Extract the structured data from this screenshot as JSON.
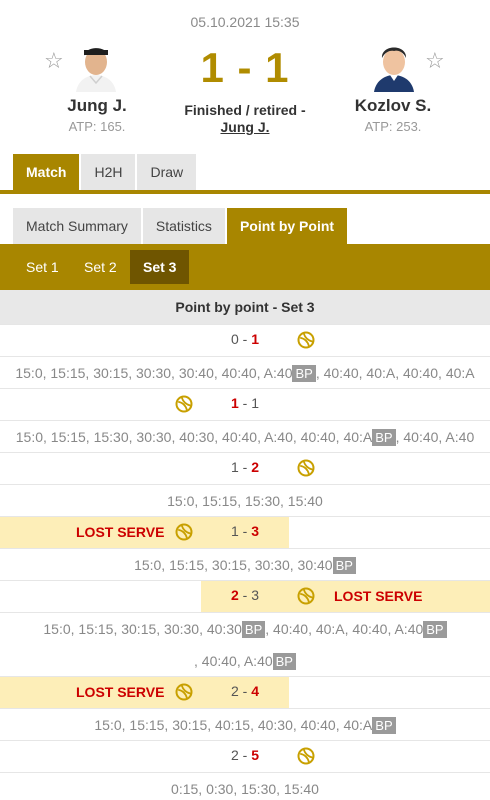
{
  "header": {
    "datetime": "05.10.2021 15:35",
    "score": "1 - 1",
    "status_line1": "Finished / retired -",
    "status_line2": "Jung J.",
    "home": {
      "name": "Jung J.",
      "rank": "ATP: 165."
    },
    "away": {
      "name": "Kozlov S.",
      "rank": "ATP: 253."
    }
  },
  "main_tabs": [
    "Match",
    "H2H",
    "Draw"
  ],
  "sub_tabs": [
    "Match Summary",
    "Statistics",
    "Point by Point"
  ],
  "set_tabs": [
    "Set 1",
    "Set 2",
    "Set 3"
  ],
  "section_title": "Point by point - Set 3",
  "lost_serve_label": "LOST SERVE",
  "games": [
    {
      "home": "0",
      "away": "1",
      "sep": "-",
      "points": [
        "15:0, 15:15, 30:15, 30:30, 30:40, 40:40, A:40",
        "BP",
        ", 40:40, 40:A, 40:40, 40:A"
      ]
    },
    {
      "home": "1",
      "away": "1",
      "sep": "-",
      "points": [
        "15:0, 15:15, 15:30, 30:30, 40:30, 40:40, A:40, 40:40, 40:A",
        "BP",
        ", 40:40, A:40"
      ]
    },
    {
      "home": "1",
      "away": "2",
      "sep": "-",
      "points": [
        "15:0, 15:15, 15:30, 15:40"
      ]
    },
    {
      "home": "1",
      "away": "3",
      "sep": "-",
      "points": [
        "15:0, 15:15, 30:15, 30:30, 30:40",
        "BP"
      ]
    },
    {
      "home": "2",
      "away": "3",
      "sep": "-",
      "points": [
        "15:0, 15:15, 30:15, 30:30, 40:30",
        "BP",
        ", 40:40, 40:A, 40:40, A:40",
        "BP",
        ", 40:40, A:40",
        "BP"
      ]
    },
    {
      "home": "2",
      "away": "4",
      "sep": "-",
      "points": [
        "15:0, 15:15, 30:15, 40:15, 40:30, 40:40, 40:A",
        "BP"
      ]
    },
    {
      "home": "2",
      "away": "5",
      "sep": "-",
      "points": [
        "0:15, 0:30, 15:30, 15:40"
      ]
    }
  ],
  "colors": {
    "accent": "#a88600",
    "lost_serve": "#cc0000",
    "highlight": "#fdeeb8"
  }
}
